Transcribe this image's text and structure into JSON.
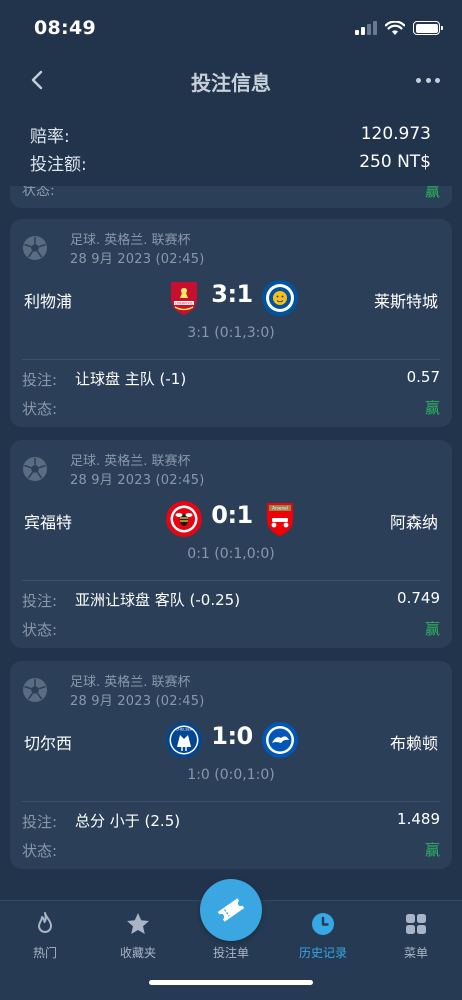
{
  "status_bar": {
    "time": "08:49"
  },
  "header": {
    "title": "投注信息"
  },
  "summary": {
    "odds_label": "赔率:",
    "odds_value": "120.973",
    "stake_label": "投注额:",
    "stake_value": "250 NT$"
  },
  "partial_card": {
    "status_label": "状态:",
    "result": "赢"
  },
  "bets": [
    {
      "league": "足球. 英格兰. 联赛杯",
      "date": "28 9月 2023 (02:45)",
      "home": "利物浦",
      "away": "莱斯特城",
      "score": "3:1",
      "score_detail": "3:1 (0:1,3:0)",
      "bet_label": "投注:",
      "bet_type": "让球盘 主队 (-1)",
      "odds": "0.57",
      "status_label": "状态:",
      "result": "赢"
    },
    {
      "league": "足球. 英格兰. 联赛杯",
      "date": "28 9月 2023 (02:45)",
      "home": "宾福特",
      "away": "阿森纳",
      "score": "0:1",
      "score_detail": "0:1 (0:1,0:0)",
      "bet_label": "投注:",
      "bet_type": "亚洲让球盘 客队 (-0.25)",
      "odds": "0.749",
      "status_label": "状态:",
      "result": "赢"
    },
    {
      "league": "足球. 英格兰. 联赛杯",
      "date": "28 9月 2023 (02:45)",
      "home": "切尔西",
      "away": "布赖顿",
      "score": "1:0",
      "score_detail": "1:0 (0:0,1:0)",
      "bet_label": "投注:",
      "bet_type": "总分 小于 (2.5)",
      "odds": "1.489",
      "status_label": "状态:",
      "result": "赢"
    }
  ],
  "crests": {
    "liverpool": "LIVERPOOL",
    "arsenal": "Arsenal",
    "chelsea": "CHELSEA"
  },
  "tabbar": {
    "hot": "热门",
    "favorites": "收藏夹",
    "betslip": "投注单",
    "history": "历史记录",
    "menu": "菜单"
  },
  "colors": {
    "background": "#22344c",
    "card": "#2b3f59",
    "win": "#2eb260",
    "accent": "#36a8e6"
  }
}
